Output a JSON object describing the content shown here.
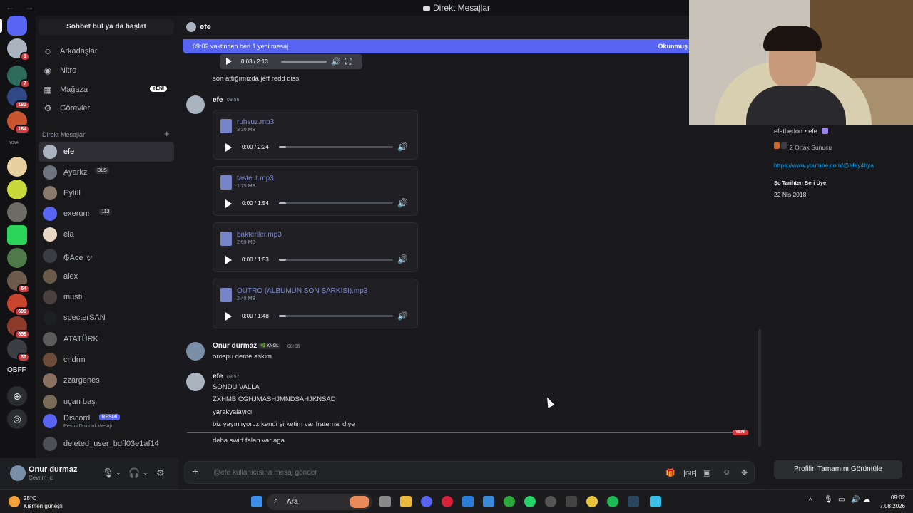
{
  "window": {
    "title": "Direkt Mesajlar",
    "nav": "← →"
  },
  "sidebar": {
    "search_label": "Sohbet bul ya da başlat",
    "nav": [
      {
        "label": "Arkadaşlar",
        "icon": "friends-icon"
      },
      {
        "label": "Nitro",
        "icon": "nitro-icon"
      },
      {
        "label": "Mağaza",
        "icon": "shop-icon",
        "badge": "YENİ"
      },
      {
        "label": "Görevler",
        "icon": "quests-icon"
      }
    ],
    "dm_header": "Direkt Mesajlar",
    "dm_plus": "+",
    "dms": [
      {
        "name": "efe",
        "color": "#aab4c0"
      },
      {
        "name": "Ayarkz",
        "tag": "DLS",
        "color": "#6d7480"
      },
      {
        "name": "Eylül",
        "color": "#8a7a6c"
      },
      {
        "name": "exerunn",
        "tag": "113",
        "color": "#5865f2"
      },
      {
        "name": "ela",
        "color": "#e8d7c2"
      },
      {
        "name": "₲Ace ッ",
        "color": "#3c3d42"
      },
      {
        "name": "alex",
        "color": "#6a5a4a"
      },
      {
        "name": "musti",
        "color": "#4a4040"
      },
      {
        "name": "specterSAN",
        "color": "#1e1f22"
      },
      {
        "name": "ATATÜRK",
        "color": "#5c5c5c"
      },
      {
        "name": "cndrm",
        "color": "#6e4c3a"
      },
      {
        "name": "zzargenes",
        "color": "#8a7060"
      },
      {
        "name": "uçan baş",
        "color": "#7a6a58"
      },
      {
        "name": "Discord",
        "tag": "RESMİ",
        "sub": "Resmi Discord Mesajı",
        "color": "#5865f2"
      },
      {
        "name": "deleted_user_bdff03e1af14",
        "color": "#4e5058"
      }
    ]
  },
  "user": {
    "name": "Onur durmaz",
    "status": "Çevrim içi"
  },
  "servers": {
    "badges": [
      "1",
      "7",
      "182",
      "184",
      "54",
      "699",
      "658",
      "32"
    ],
    "label": "OBFF",
    "tags": [
      "NOVA"
    ]
  },
  "chat": {
    "recipient": "efe",
    "new_bar": {
      "text": "09:02 vaktinden beri 1 yeni mesaj",
      "action": "Okunmuş"
    },
    "top_player_time": "0:03 / 2:13",
    "top_text": "son attığımızda jeff redd diss",
    "m1": {
      "author": "efe",
      "time": "08:56"
    },
    "audios": [
      {
        "name": "ruhsuz.mp3",
        "size": "3.30 MB",
        "time": "0:00 / 2:24"
      },
      {
        "name": "taste it.mp3",
        "size": "1.75 MB",
        "time": "0:00 / 1:54"
      },
      {
        "name": "bakteriler.mp3",
        "size": "2.59 MB",
        "time": "0:00 / 1:53"
      },
      {
        "name": "OUTRO (ALBUMUN SON ŞARKISI).mp3",
        "size": "2.48 MB",
        "time": "0:00 / 1:48"
      }
    ],
    "m2": {
      "author": "Onur durmaz",
      "tag": "KNGL",
      "time": "08:56",
      "text": "orospu deme askim"
    },
    "m3": {
      "author": "efe",
      "time": "08:57",
      "lines": [
        "SONDU VALLA",
        "ZXHMB CGHJMASHJMNDSAHJKNSAD",
        "yarakyalayıcı",
        "biz yayınlıyoruz kendi şirketim var fraternal diye"
      ]
    },
    "new_tag": "YENİ",
    "last_text": "deha swirf falan var aga",
    "composer_placeholder": "@efe kullanıcısına mesaj gönder"
  },
  "profile": {
    "handle": "efethedon • efe",
    "mutual": "2 Ortak Sunucu",
    "link": "https://www.youtube.com/@efey4hya",
    "since_header": "Şu Tarihten Beri Üye:",
    "since": "22 Nis 2018",
    "button": "Profilin Tamamını Görüntüle"
  },
  "taskbar": {
    "temp": "25°C",
    "weather": "Kısmen güneşli",
    "search": "Ara",
    "time": "09:02",
    "date": "7.08.2026"
  }
}
